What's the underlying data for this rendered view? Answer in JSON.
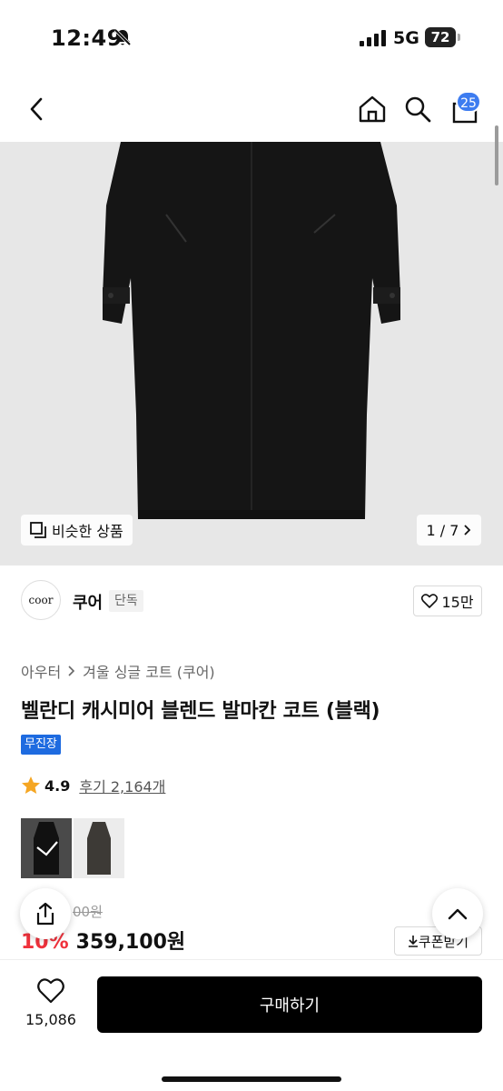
{
  "status_bar": {
    "time": "12:49",
    "network": "5G",
    "battery": "72"
  },
  "nav": {
    "back_icon": "chevron-left-icon",
    "home_icon": "home-icon",
    "search_icon": "search-icon",
    "cart_icon": "shopping-bag-icon",
    "cart_count": "25"
  },
  "gallery": {
    "similar_label": "비슷한 상품",
    "page_indicator": "1 / 7"
  },
  "brand": {
    "logo_text": "coor",
    "name": "쿠어",
    "tag": "단독",
    "likes": "15만"
  },
  "breadcrumb": {
    "items": [
      "아우터",
      "겨울 싱글 코트 (쿠어)"
    ]
  },
  "product": {
    "title": "벨란디 캐시미어 블렌드 발마칸 코트 (블랙)",
    "shipping_badge": "무진장",
    "rating": "4.9",
    "reviews": "후기 2,164개",
    "original_price_visible": "00원",
    "discount_visible": "10%",
    "price": "359,100원",
    "coupon_label": "쿠폰받기"
  },
  "colors": {
    "brand_blue": "#1e6be0",
    "discount_red": "#f0323c",
    "badge_blue": "#3d7cf0",
    "star": "#f5a623"
  },
  "bottom_bar": {
    "wish_count": "15,086",
    "buy_label": "구매하기"
  }
}
